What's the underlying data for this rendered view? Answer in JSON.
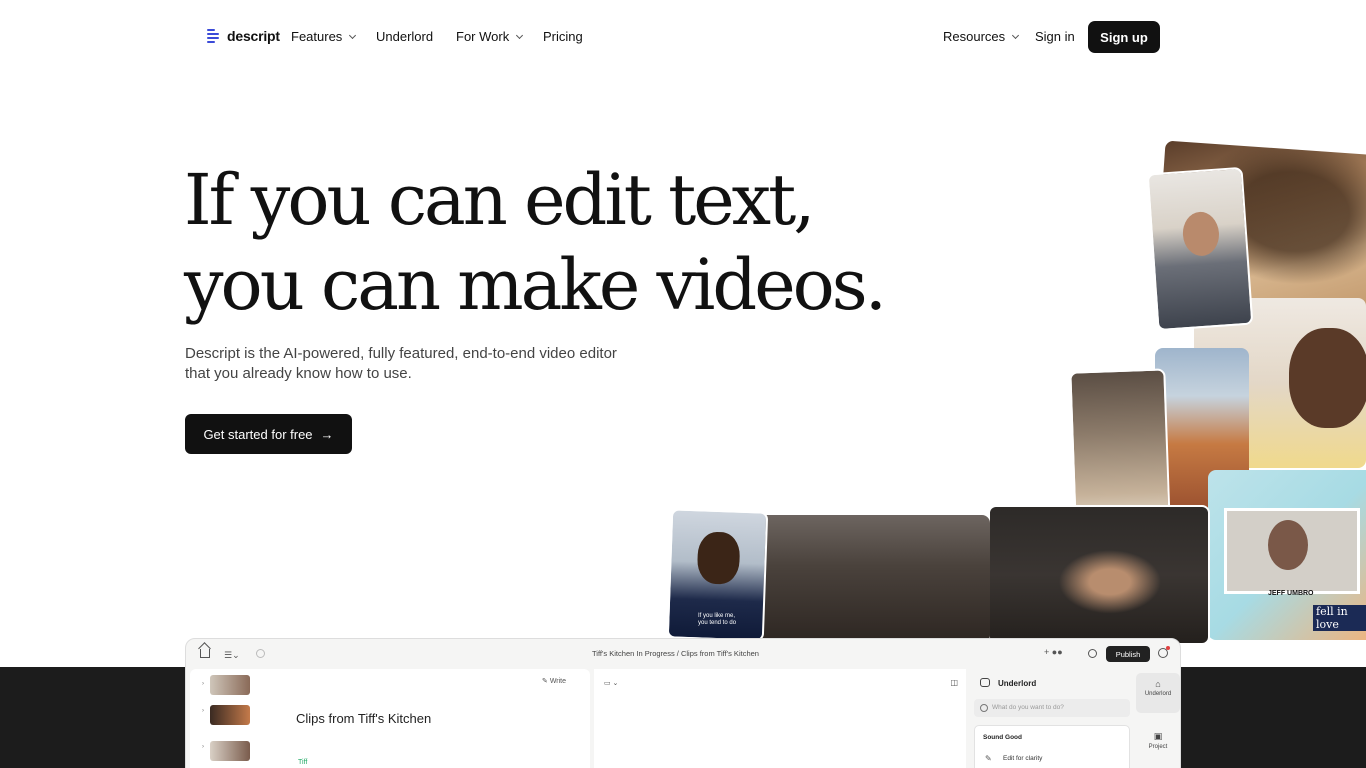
{
  "nav": {
    "logo_text": "descript",
    "items": [
      {
        "label": "Features",
        "dropdown": true
      },
      {
        "label": "Underlord",
        "dropdown": false
      },
      {
        "label": "For Work",
        "dropdown": true
      },
      {
        "label": "Pricing",
        "dropdown": false
      }
    ],
    "resources_label": "Resources",
    "signin_label": "Sign in",
    "signup_label": "Sign up"
  },
  "hero": {
    "headline_line1": "If you can edit text,",
    "headline_line2": "you can make videos.",
    "subtext": "Descript is the AI-powered, fully featured, end-to-end video editor that you already know how to use.",
    "cta_label": "Get started for free",
    "cta_arrow": "→"
  },
  "collage": {
    "jeff_label": "JEFF UMBRO",
    "love_label": "fell in love",
    "caption_small": "If you like me,\nyou tend to do"
  },
  "app": {
    "breadcrumb": "Tiff's Kitchen In Progress  /  Clips from Tiff's Kitchen",
    "publish_label": "Publish",
    "write_label": "Write",
    "doc_title": "Clips from Tiff's Kitchen",
    "speaker": "Tiff",
    "underlord_title": "Underlord",
    "underlord_placeholder": "What do you want to do?",
    "card_title": "Sound Good",
    "card_item": "Edit for clarity",
    "side_underlord": "Underlord",
    "side_project": "Project"
  },
  "colors": {
    "brand_blue": "#3b4bd8",
    "button_dark": "#111111",
    "band_dark": "#1c1c1c"
  }
}
